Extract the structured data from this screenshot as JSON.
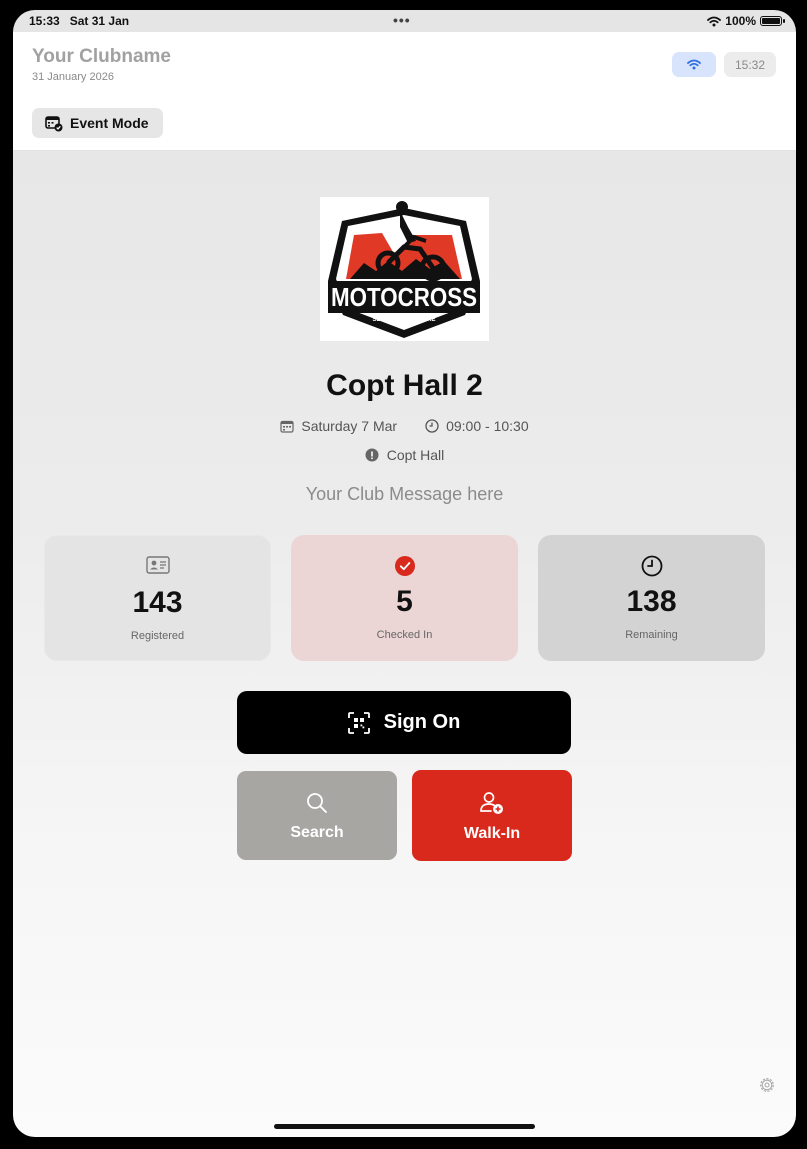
{
  "status_bar": {
    "time": "15:33",
    "date": "Sat 31 Jan",
    "multitask_dots": "•••",
    "battery": "100%",
    "icons": [
      "wifi-icon",
      "battery-icon"
    ]
  },
  "header": {
    "club_name": "Your Clubname",
    "date": "31 January 2026",
    "clock": "15:32",
    "event_mode_label": "Event Mode",
    "icons": [
      "wifi-icon",
      "calendar-check-icon"
    ]
  },
  "event": {
    "logo_text": "MOTOCROSS",
    "logo_slogan": "SLOGAN GOES HERE",
    "title": "Copt Hall 2",
    "date": "Saturday 7 Mar",
    "time_range": "09:00 - 10:30",
    "venue": "Copt Hall",
    "club_message": "Your Club Message here",
    "icons": [
      "calendar-icon",
      "clock-icon",
      "location-pin-icon"
    ]
  },
  "stats": {
    "registered": {
      "value": "143",
      "label": "Registered",
      "icon": "id-card-icon"
    },
    "checked_in": {
      "value": "5",
      "label": "Checked In",
      "icon": "checkmark-circle-icon"
    },
    "remaining": {
      "value": "138",
      "label": "Remaining",
      "icon": "clock-icon"
    }
  },
  "actions": {
    "sign_on": {
      "label": "Sign On",
      "icon": "qr-scan-icon"
    },
    "search": {
      "label": "Search",
      "icon": "search-icon"
    },
    "walk_in": {
      "label": "Walk-In",
      "icon": "add-person-icon"
    }
  },
  "footer": {
    "icon": "gear-icon"
  },
  "colors": {
    "accent_red": "#d9291c",
    "checked_in_bg": "#ecd6d5",
    "wifi_pill_bg": "#d7e4fb",
    "wifi_blue": "#2f6fe0",
    "sign_on_bg": "#000000",
    "search_bg": "#a7a6a3"
  }
}
